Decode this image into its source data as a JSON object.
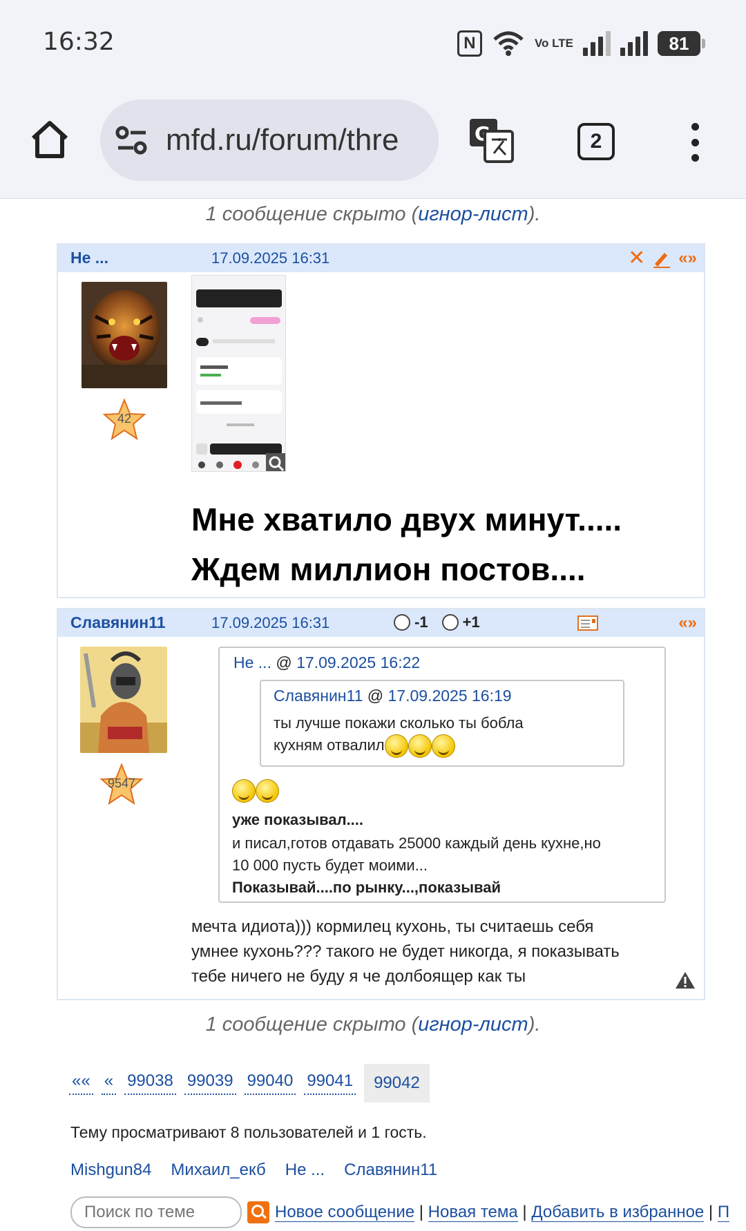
{
  "status": {
    "time": "16:32",
    "battery": "81",
    "nfc": "N",
    "volte": "Vo LTE"
  },
  "browser": {
    "url": "mfd.ru/forum/thre",
    "tabs_count": "2"
  },
  "hidden_note": {
    "prefix": "1 сообщение скрыто (",
    "link": "игнор-лист",
    "suffix": ")."
  },
  "posts": [
    {
      "author": "Не ...",
      "date": "17.09.2025 16:31",
      "rating": "42",
      "nav": "«»",
      "text_lines": [
        "Мне хватило двух минут.....",
        "Ждем миллион постов...."
      ]
    },
    {
      "author": "Славянин11",
      "date": "17.09.2025 16:31",
      "rating": "9547",
      "nav": "«»",
      "vote_minus": "-1",
      "vote_plus": "+1",
      "quote": {
        "header_author": "Не ...",
        "header_sep": " @ ",
        "header_date": "17.09.2025 16:22",
        "inner": {
          "header_author": "Славянин11",
          "header_sep": " @ ",
          "header_date": "17.09.2025 16:19",
          "line1": "ты лучше покажи сколько ты бобла",
          "line2": "кухням отвалил"
        },
        "bold1": "уже показывал....",
        "line1": "и писал,готов отдавать 25000 каждый день кухне,но",
        "line2": "10 000 пусть будет моими...",
        "bold2": "Показывай....по рынку...,показывай"
      },
      "text_lines": [
        "мечта идиота))) кормилец кухонь, ты считаешь себя",
        "умнее кухонь??? такого не будет никогда, я показывать",
        "тебе ничего не буду я че долбоящер как ты"
      ]
    }
  ],
  "pager": {
    "first": "««",
    "prev": "«",
    "pages": [
      "99038",
      "99039",
      "99040",
      "99041"
    ],
    "current": "99042"
  },
  "viewing": "Тему просматривают 8 пользователей и 1 гость.",
  "users": [
    "Mishgun84",
    "Михаил_екб",
    "Не ...",
    "Славянин11"
  ],
  "search": {
    "placeholder": "Поиск по теме"
  },
  "bottom_links": {
    "new_message": "Новое сообщение",
    "new_topic": "Новая тема",
    "add_fav": "Добавить в избранное",
    "more": "П",
    "sep": " | "
  }
}
